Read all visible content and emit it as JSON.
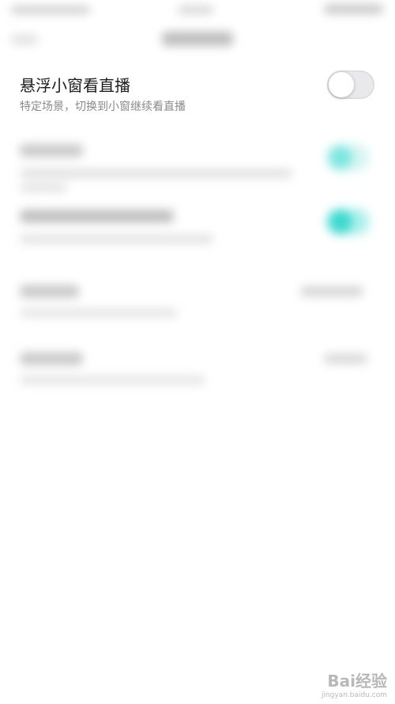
{
  "pip_setting": {
    "title": "悬浮小窗看直播",
    "description": "特定场景，切换到小窗继续看直播",
    "toggle_on": false
  },
  "colors": {
    "accent": "#3fd8d0",
    "toggle_off": "#e9e9ec",
    "text_primary": "#1b1b1b",
    "text_secondary": "#8a8a8a"
  },
  "watermark": {
    "brand": "Bai经验",
    "url": "jingyan.baidu.com"
  }
}
